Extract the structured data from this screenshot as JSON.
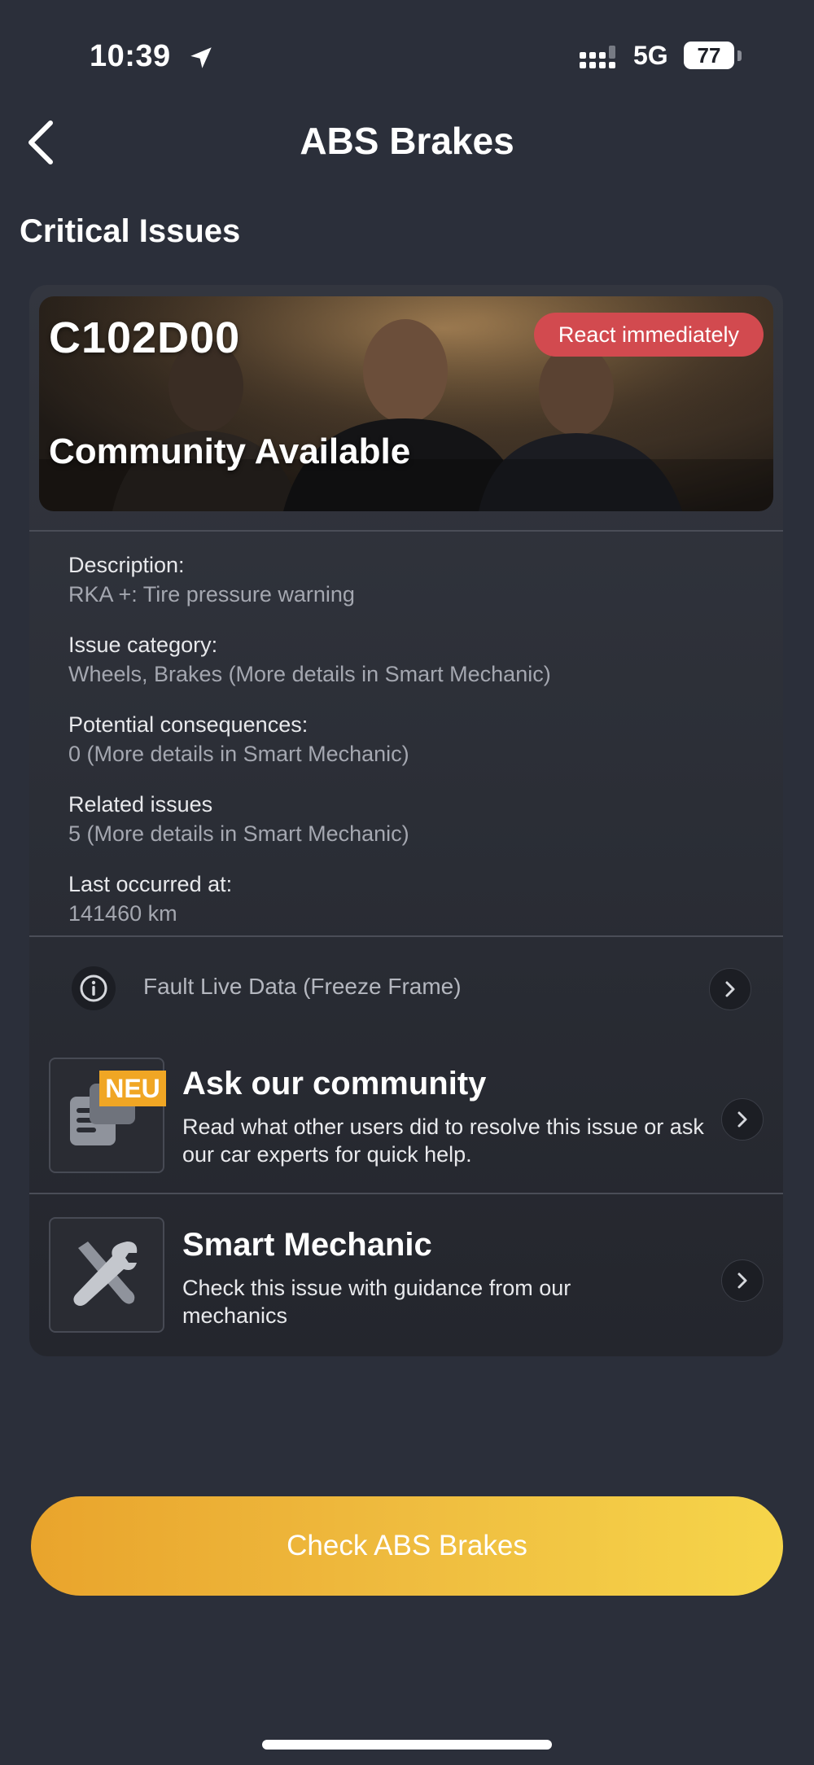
{
  "status_bar": {
    "time": "10:39",
    "network": "5G",
    "battery": "77"
  },
  "header": {
    "title": "ABS Brakes"
  },
  "section": {
    "title": "Critical Issues"
  },
  "issue": {
    "code": "C102D00",
    "badge": "React immediately",
    "hero_subtitle": "Community Available",
    "details": [
      {
        "label": "Description:",
        "value": "RKA +: Tire pressure warning"
      },
      {
        "label": "Issue category:",
        "value": "Wheels, Brakes (More details in Smart Mechanic)"
      },
      {
        "label": "Potential consequences:",
        "value": "0 (More details in Smart Mechanic)"
      },
      {
        "label": "Related issues",
        "value": "5 (More details in Smart Mechanic)"
      },
      {
        "label": "Last occurred at:",
        "value": "141460 km"
      }
    ],
    "freeze_frame_label": "Fault Live Data (Freeze Frame)"
  },
  "community": {
    "new_badge": "NEU",
    "title": "Ask our community",
    "description": "Read what other users did to resolve this issue or ask our car experts for quick help."
  },
  "smart_mechanic": {
    "title": "Smart Mechanic",
    "description": "Check this issue with guidance from our mechanics"
  },
  "cta": {
    "label": "Check ABS Brakes"
  },
  "colors": {
    "background": "#2b2f3a",
    "badge_red": "#d24a4f",
    "cta_gradient_start": "#e9a42c",
    "cta_gradient_end": "#f6d54a",
    "new_badge_orange": "#f0a624"
  },
  "icons": {
    "back": "chevron-left-icon",
    "location": "location-arrow-icon",
    "signal": "signal-icon",
    "info": "info-circle-icon",
    "chevron": "chevron-right-icon",
    "community": "chat-bubbles-icon",
    "mechanic": "wrench-screwdriver-icon"
  }
}
